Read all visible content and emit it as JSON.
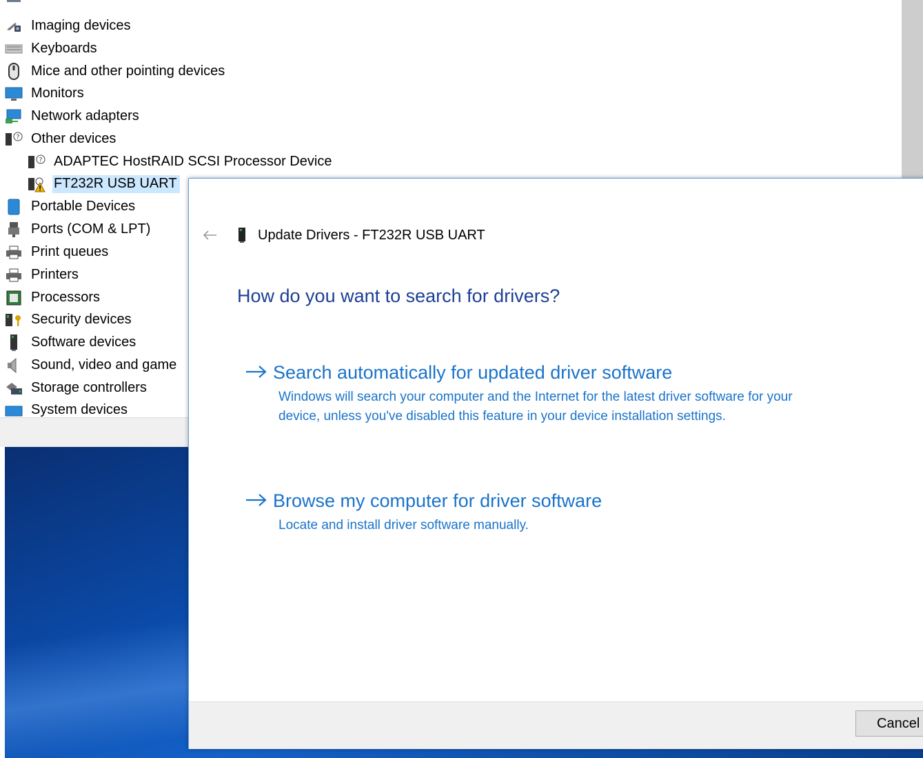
{
  "device_tree": {
    "items": [
      {
        "label": "Imaging devices",
        "icon": "camera-icon"
      },
      {
        "label": "Keyboards",
        "icon": "keyboard-icon"
      },
      {
        "label": "Mice and other pointing devices",
        "icon": "mouse-icon"
      },
      {
        "label": "Monitors",
        "icon": "monitor-icon"
      },
      {
        "label": "Network adapters",
        "icon": "network-adapter-icon"
      },
      {
        "label": "Other devices",
        "icon": "unknown-device-icon"
      },
      {
        "label": "ADAPTEC HostRAID SCSI Processor Device",
        "icon": "unknown-device-icon"
      },
      {
        "label": "FT232R USB UART",
        "icon": "warning-device-icon"
      },
      {
        "label": "Portable Devices",
        "icon": "portable-device-icon"
      },
      {
        "label": "Ports (COM & LPT)",
        "icon": "port-icon"
      },
      {
        "label": "Print queues",
        "icon": "printer-icon"
      },
      {
        "label": "Printers",
        "icon": "printer-icon"
      },
      {
        "label": "Processors",
        "icon": "processor-icon"
      },
      {
        "label": "Security devices",
        "icon": "security-device-icon"
      },
      {
        "label": "Software devices",
        "icon": "software-device-icon"
      },
      {
        "label": "Sound, video and game",
        "icon": "speaker-icon"
      },
      {
        "label": "Storage controllers",
        "icon": "storage-controller-icon"
      },
      {
        "label": "System devices",
        "icon": "system-device-icon"
      }
    ],
    "selected": "FT232R USB UART"
  },
  "dialog": {
    "title": "Update Drivers - FT232R USB UART",
    "question": "How do you want to search for drivers?",
    "options": [
      {
        "title": "Search automatically for updated driver software",
        "description": "Windows will search your computer and the Internet for the latest driver software for your device, unless you've disabled this feature in your device installation settings."
      },
      {
        "title": "Browse my computer for driver software",
        "description": "Locate and install driver software manually."
      }
    ],
    "cancel_label": "Cancel"
  },
  "colors": {
    "link_blue": "#1a73c9",
    "heading_blue": "#1c3f94",
    "selection": "#cce8ff"
  }
}
